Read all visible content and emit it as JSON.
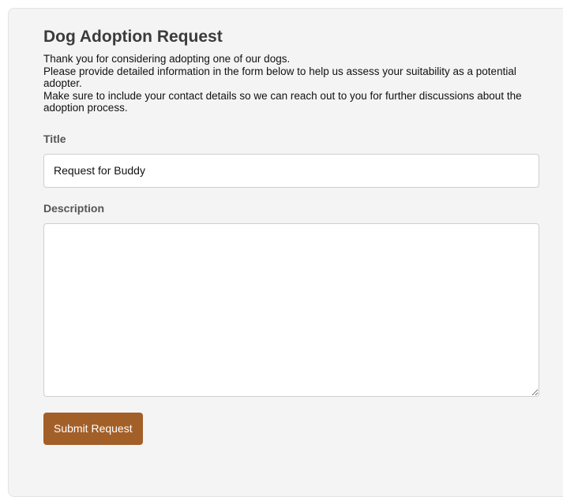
{
  "form": {
    "title": "Dog Adoption Request",
    "intro_lines": [
      "Thank you for considering adopting one of our dogs.",
      "Please provide detailed information in the form below to help us assess your suitability as a potential adopter.",
      "Make sure to include your contact details so we can reach out to you for further discussions about the adoption process."
    ],
    "title_field": {
      "label": "Title",
      "value": "Request for Buddy"
    },
    "description_field": {
      "label": "Description",
      "value": ""
    },
    "submit_label": "Submit Request"
  },
  "colors": {
    "card_background": "#f4f4f4",
    "heading": "#3b3b3b",
    "label": "#555555",
    "button": "#a35f28"
  }
}
